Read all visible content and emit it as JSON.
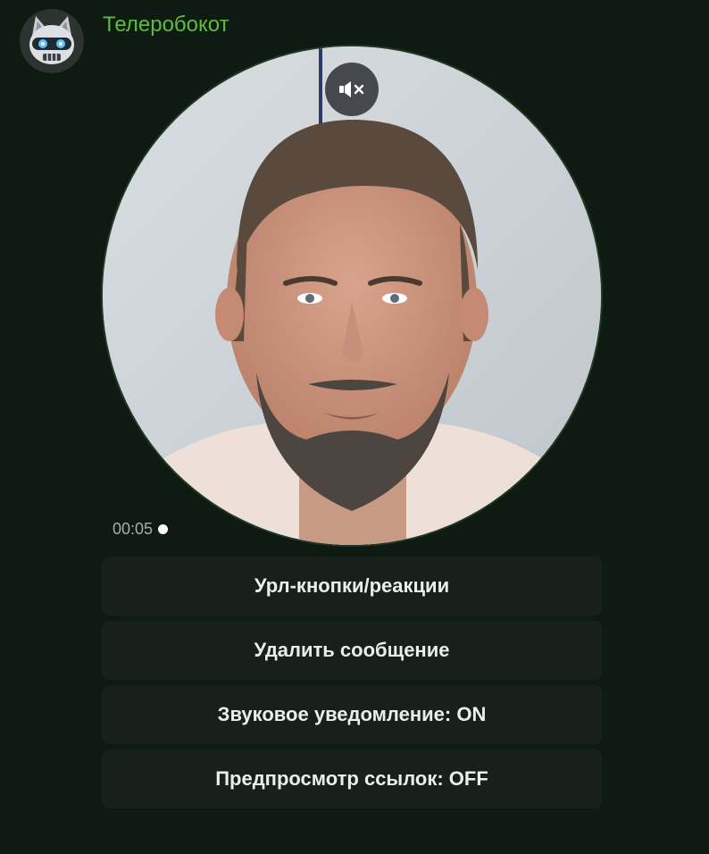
{
  "message": {
    "sender_name": "Телеробокот",
    "avatar_icon": "robot-cat-avatar",
    "video_duration": "00:05",
    "mute_icon": "speaker-muted-icon",
    "unread": true
  },
  "inline_keyboard": [
    {
      "label": "Урл-кнопки/реакции"
    },
    {
      "label": "Удалить сообщение"
    },
    {
      "label": "Звуковое уведомление: ON"
    },
    {
      "label": "Предпросмотр ссылок: OFF"
    }
  ],
  "colors": {
    "background": "#0f1a13",
    "sender_name": "#5cbd3d",
    "button_bg": "#172019",
    "button_text": "#eceeed",
    "duration_text": "#a6aeaa"
  }
}
